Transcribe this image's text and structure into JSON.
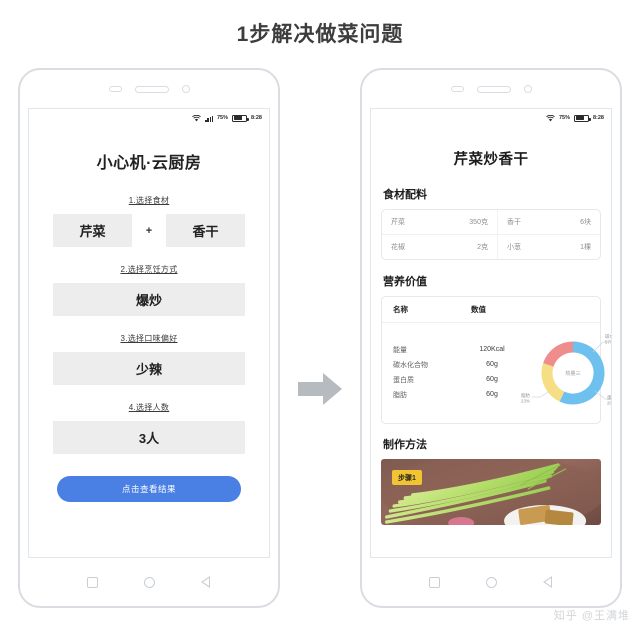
{
  "page": {
    "title": "1步解决做菜问题",
    "watermark": "知乎 @王满堆"
  },
  "status_bar": {
    "battery_percent": "75%",
    "time": "8:28",
    "wifi_icon": "wifi-icon",
    "signal_icon": "signal-bars-icon",
    "battery_icon": "battery-icon"
  },
  "left_phone": {
    "app_title": "小心机·云厨房",
    "steps": [
      {
        "label": "1.选择食材",
        "type": "dual",
        "value_a": "芹菜",
        "separator": "+",
        "value_b": "香干"
      },
      {
        "label": "2.选择烹饪方式",
        "type": "single",
        "value": "爆炒"
      },
      {
        "label": "3.选择口味偏好",
        "type": "single",
        "value": "少辣"
      },
      {
        "label": "4.选择人数",
        "type": "single",
        "value": "3人"
      }
    ],
    "submit_label": "点击查看结果",
    "submit_color": "#4a80e3",
    "nav": {
      "recent_icon": "square-icon",
      "home_icon": "circle-icon",
      "back_icon": "triangle-back-icon"
    }
  },
  "right_phone": {
    "recipe_title": "芹菜炒香干",
    "ingredients_section": {
      "heading": "食材配料",
      "rows": [
        {
          "name_a": "芹菜",
          "amount_a": "350克",
          "name_b": "香干",
          "amount_b": "6块"
        },
        {
          "name_a": "花椒",
          "amount_a": "2克",
          "name_b": "小葱",
          "amount_b": "1棵"
        }
      ]
    },
    "nutrition_section": {
      "heading": "营养价值",
      "columns": [
        "名称",
        "数值"
      ],
      "rows": [
        {
          "name": "能量",
          "value": "120Kcal"
        },
        {
          "name": "碳水化合物",
          "value": "60g"
        },
        {
          "name": "蛋白质",
          "value": "60g"
        },
        {
          "name": "脂肪",
          "value": "60g"
        }
      ]
    },
    "method_section": {
      "heading": "制作方法",
      "step_badge": "步骤1"
    },
    "nav": {
      "recent_icon": "square-icon",
      "home_icon": "circle-icon",
      "back_icon": "triangle-back-icon"
    }
  },
  "arrow": {
    "name": "right-arrow",
    "color": "#b6bbc0"
  },
  "chart_data": {
    "type": "pie",
    "title": "热量三",
    "center_label": "热量三",
    "categories": [
      "碳水",
      "蛋白质",
      "脂肪"
    ],
    "values": [
      57,
      20,
      23
    ],
    "labels": [
      "碳水 57%",
      "蛋白质 20%",
      "脂肪 23%"
    ],
    "label_lines": [
      {
        "name": "碳水",
        "percent": "57%",
        "color": "#6ec0ef"
      },
      {
        "name": "蛋白质",
        "percent": "20%",
        "color": "#f6de84"
      },
      {
        "name": "脂肪",
        "percent": "23%",
        "color": "#ef8d8d"
      }
    ],
    "colors": [
      "#6ec0ef",
      "#f6de84",
      "#ef8d8d"
    ],
    "legend_position": "callout",
    "donut": true
  }
}
